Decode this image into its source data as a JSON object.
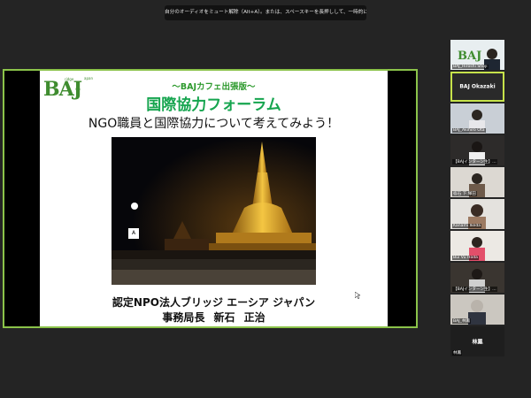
{
  "notice": "自分のオーディオをミュート解除（Alt+A）。または、スペースキーを長押しして、一時的にミュートを解除します。",
  "slide": {
    "logo_text": "BAJ",
    "logo_small_1": "ridge",
    "logo_small_2": "sia",
    "logo_small_3": "apan",
    "subtitle": "～BAJカフェ出張版～",
    "title": "国際協力フォーラム",
    "question": "NGO職員と国際協力について考えてみよう！",
    "photo_tag": "A",
    "organization": "認定NPO法人ブリッジ エーシア ジャパン",
    "presenter": "事務局長 新石 正治"
  },
  "participants": [
    {
      "name": "BAJ_Hiroshi Shoji",
      "video": true
    },
    {
      "name": "BAJ Okazaki",
      "video": false,
      "active": true
    },
    {
      "name": "BAJ_Akihiro Ota",
      "video": true
    },
    {
      "name": "【BAJインターン生】…",
      "video": true
    },
    {
      "name": "宿石 下 塚田",
      "video": true
    },
    {
      "name": "Kanami Ikeda",
      "video": true
    },
    {
      "name": "Bui Vu Hoda",
      "video": true
    },
    {
      "name": "【BAJインターン生】…",
      "video": true
    },
    {
      "name": "BAJ_林鳳",
      "video": true
    },
    {
      "name": "林鳳",
      "video": false,
      "center_label": "林鳳"
    }
  ],
  "colors": {
    "background": "#242424",
    "active_speaker_border": "#c6e24a",
    "share_border": "#8bc34a",
    "title_green": "#16a54f"
  }
}
